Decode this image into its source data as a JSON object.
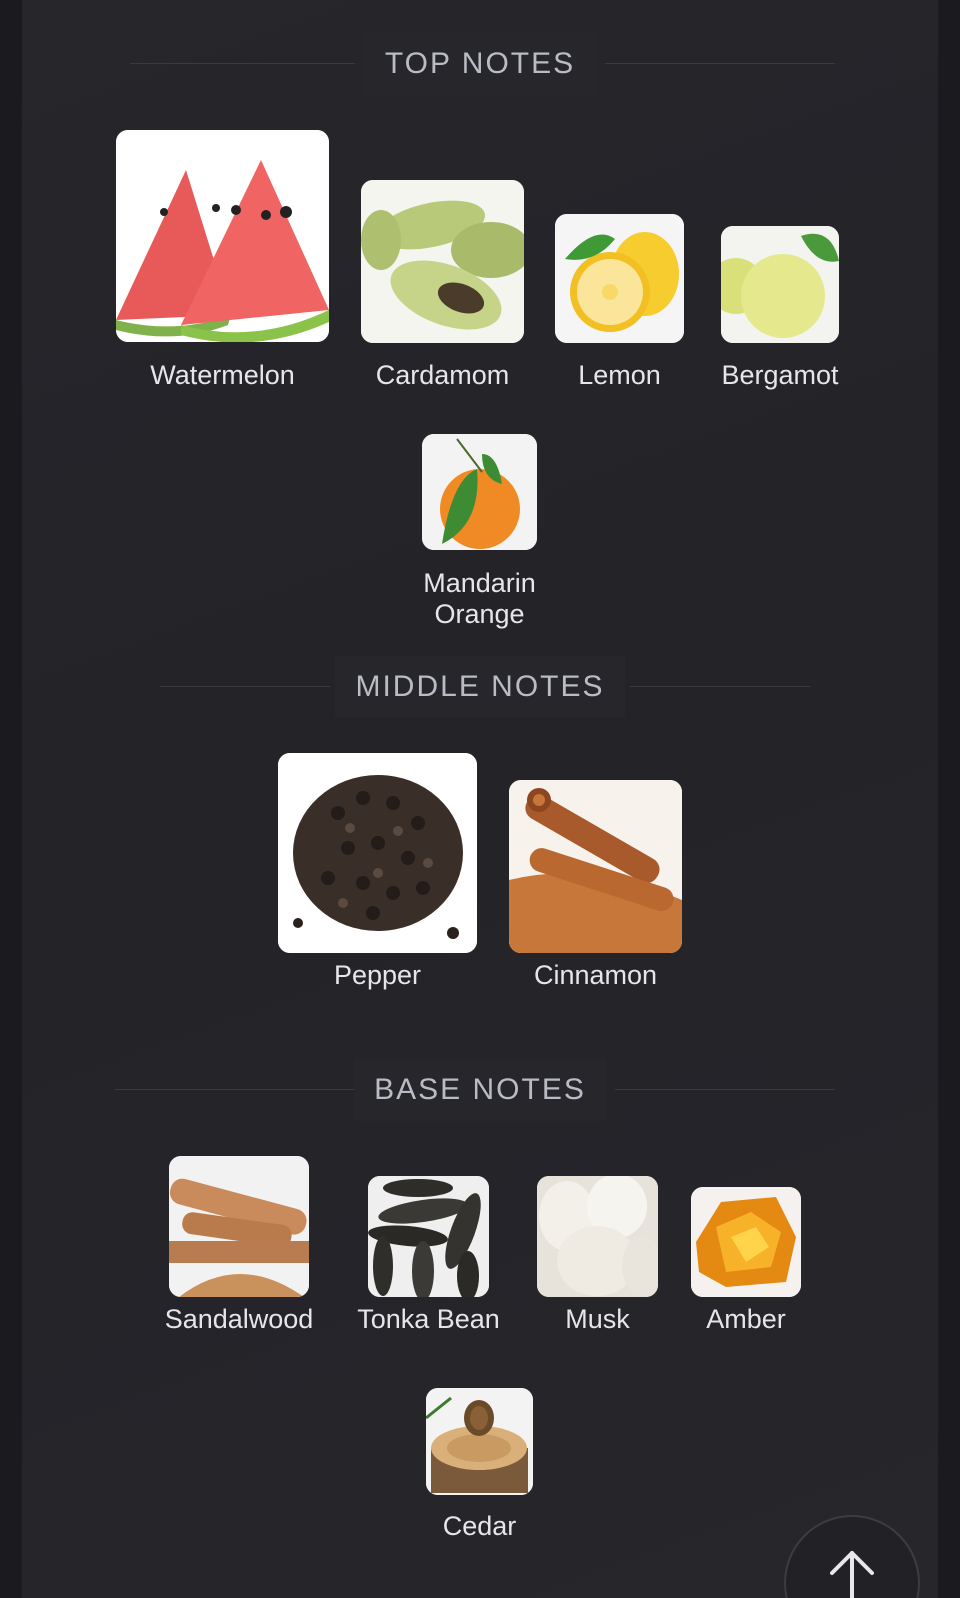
{
  "sections": {
    "top": {
      "title": "TOP NOTES",
      "notes": [
        "Watermelon",
        "Cardamom",
        "Lemon",
        "Bergamot",
        "Mandarin Orange"
      ]
    },
    "middle": {
      "title": "MIDDLE NOTES",
      "notes": [
        "Pepper",
        "Cinnamon"
      ]
    },
    "base": {
      "title": "BASE NOTES",
      "notes": [
        "Sandalwood",
        "Tonka Bean",
        "Musk",
        "Amber",
        "Cedar"
      ]
    }
  },
  "icons": {
    "scroll_top": "arrow-up-icon"
  },
  "colors": {
    "background": "#26262b",
    "section_title": "#b9bcc4",
    "note_label": "#e6e6ea"
  }
}
